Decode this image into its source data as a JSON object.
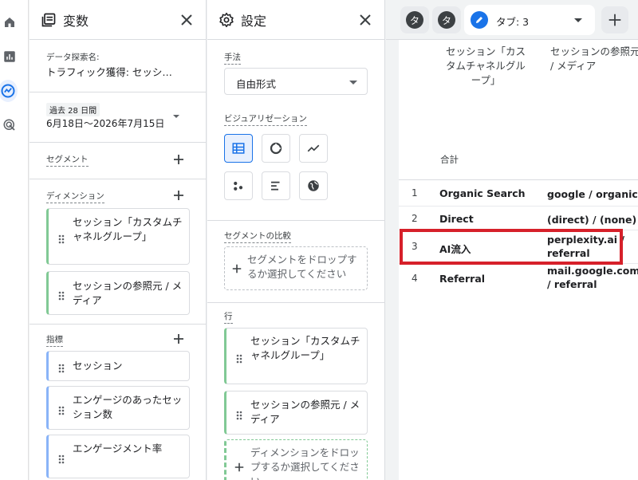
{
  "rail": {
    "items": [
      "home-icon",
      "reports-icon",
      "explore-icon",
      "advertising-icon"
    ],
    "active_index": 2
  },
  "variables_panel": {
    "title": "変数",
    "exploration_name_label": "データ探索名:",
    "exploration_name_value": "トラフィック獲得: セッシ…",
    "date_badge": "過去 28 日間",
    "date_range": "6月18日～2026年7月15日",
    "segments_label": "セグメント",
    "dimensions_label": "ディメンション",
    "dimensions": [
      "セッション「カスタムチャネルグループ」",
      "セッションの参照元 / メディア"
    ],
    "metrics_label": "指標",
    "metrics": [
      "セッション",
      "エンゲージのあったセッション数",
      "エンゲージメント率"
    ]
  },
  "settings_panel": {
    "title": "設定",
    "technique_label": "手法",
    "technique_value": "自由形式",
    "visualization_label": "ビジュアリゼーション",
    "segment_compare_label": "セグメントの比較",
    "segment_drop_text": "セグメントをドロップするか選択してください",
    "rows_label": "行",
    "rows": [
      "セッション「カスタムチャネルグループ」",
      "セッションの参照元 / メディア"
    ],
    "dimension_drop_text": "ディメンションをドロップするか選択してください"
  },
  "tabs": {
    "inactive_1": "タ",
    "inactive_2": "タ",
    "active_name": "タブ: 3"
  },
  "table": {
    "col1_header": "セッション「カスタムチャネルグループ」",
    "col2_header": "セッションの参照元 / メディア",
    "total_label": "合計",
    "rows": [
      {
        "n": "1",
        "channel": "Organic Search",
        "source": "google / organic"
      },
      {
        "n": "2",
        "channel": "Direct",
        "source": "(direct) / (none)"
      },
      {
        "n": "3",
        "channel": "AI流入",
        "source": "perplexity.ai / referral"
      },
      {
        "n": "4",
        "channel": "Referral",
        "source": "mail.google.com / referral"
      }
    ]
  },
  "colors": {
    "accent": "#1a73e8",
    "dimension_chip": "#81c995",
    "metric_chip": "#8ab4f8",
    "highlight": "#d6202a"
  }
}
